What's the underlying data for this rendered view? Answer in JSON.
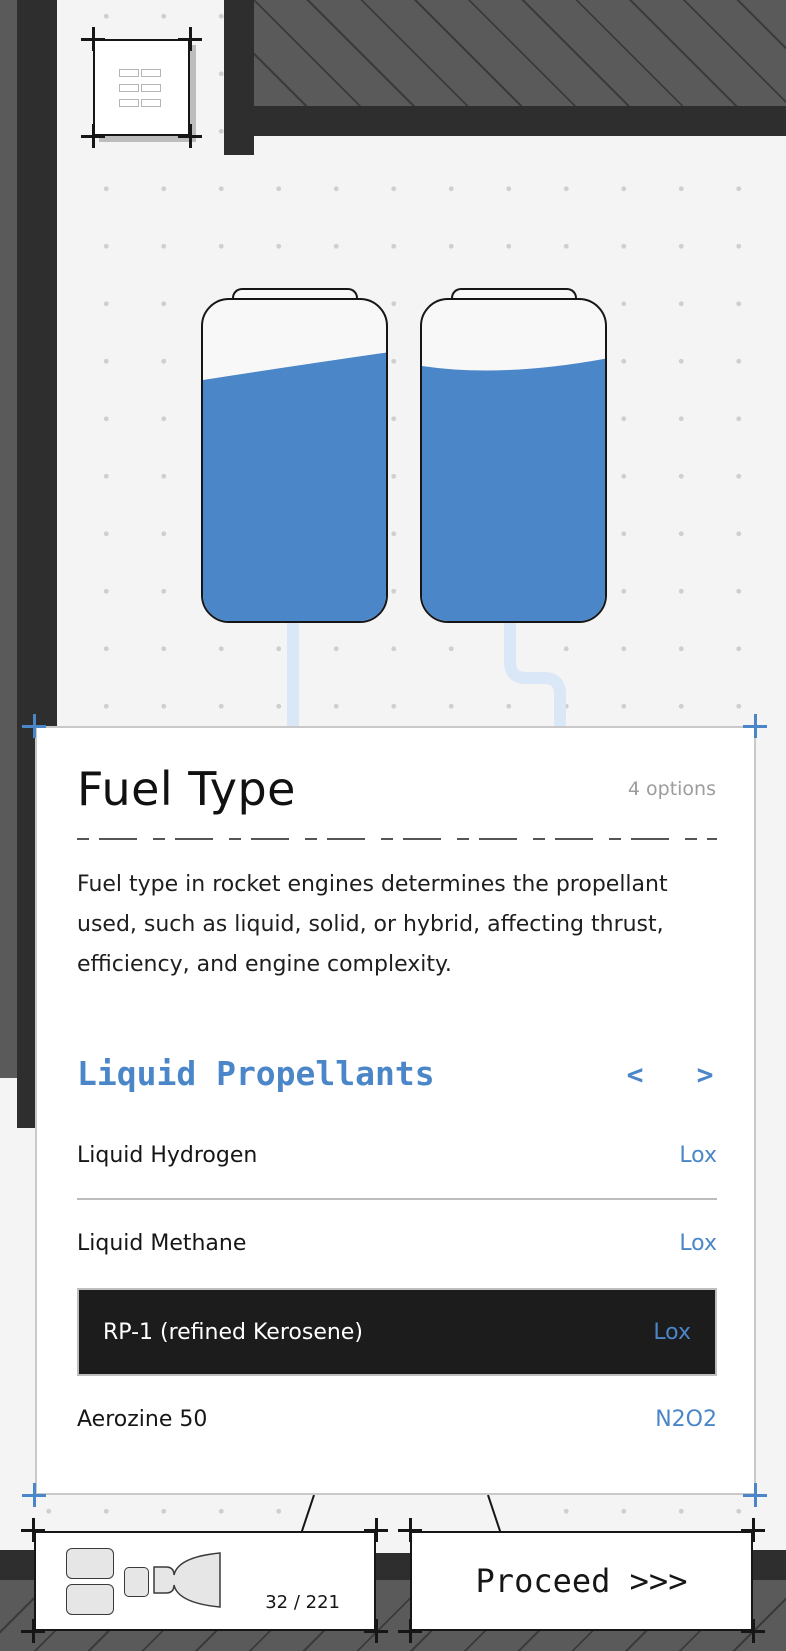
{
  "colors": {
    "accent": "#4a86c8",
    "selected_bg": "#1c1c1c",
    "fuel": "#4a86c8"
  },
  "icons": {
    "top_left": "grid-icon",
    "tanks": "fuel-tank-icon",
    "engine": "engine-diagram-icon"
  },
  "card": {
    "title": "Fuel Type",
    "count": "4 options",
    "description": "Fuel type in rocket engines determines the propellant used, such as liquid, solid, or hybrid, affecting thrust, efficiency, and engine complexity.",
    "section_title": "Liquid Propellants",
    "prev": "<",
    "next": ">",
    "options": [
      {
        "label": "Liquid Hydrogen",
        "value": "Lox",
        "selected": false
      },
      {
        "label": "Liquid Methane",
        "value": "Lox",
        "selected": false
      },
      {
        "label": "RP-1 (refined Kerosene)",
        "value": "Lox",
        "selected": true
      },
      {
        "label": "Aerozine 50",
        "value": "N2O2",
        "selected": false
      }
    ]
  },
  "footer": {
    "counter": "32 / 221",
    "proceed": "Proceed >>>"
  }
}
